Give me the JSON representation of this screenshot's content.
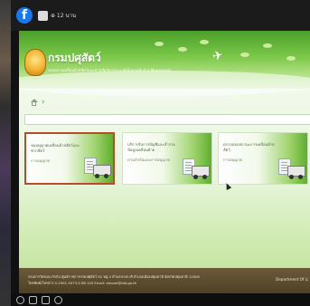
{
  "topbar": {
    "post_time": "⊕ 12 นาน"
  },
  "site": {
    "org_name": "กรมปศุสัตว์",
    "org_subtitle": "ระบบการเคลื่อนย้ายสัตว์และซากสัตว์ทางระบบอิเล็กทรอนิกส์ e-Movement",
    "breadcrumb_sep": "›",
    "cards": [
      {
        "title": "ขออนุญาตเคลื่อนย้ายสัตว์และซากสัตว์",
        "sub": "การอนุญาต"
      },
      {
        "title": "บริการรับการปัญชีและสำรวจข้อมูลเคลื่อนย้าย",
        "sub": "ด่านกักกันและการอนุญาต"
      },
      {
        "title": "ตรวจสอบสถานะการเคลื่อนย้ายสัตว์",
        "sub": "การอนุญาต"
      }
    ],
    "footer_line1": "กองสารวัตรและกักกัน ศูนย์ราชการกรมปศุสัตว์ 91 หมู่ 4 ตำบลบางกะดี อำเภอเมืองปทุมธานี จังหวัดปทุมธานี 12000",
    "footer_line2": "โทรศัพท์/โทรสาร 0-2501-3473-5 ต่อ 100 Email: emove@dld.go.th",
    "footer_right": "Department Of Li"
  }
}
